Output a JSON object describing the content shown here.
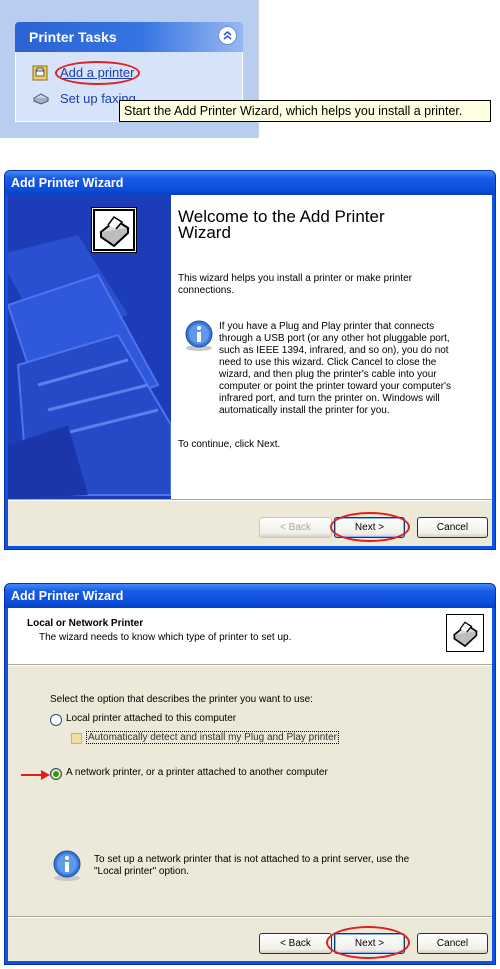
{
  "printer_tasks": {
    "title": "Printer Tasks",
    "items": [
      {
        "label": "Add a printer",
        "icon": "add-printer-icon"
      },
      {
        "label": "Set up faxing",
        "icon": "fax-icon"
      }
    ],
    "tooltip": "Start the Add Printer Wizard, which helps you install a printer."
  },
  "wizard1": {
    "window_title": "Add Printer Wizard",
    "heading": "Welcome to the Add Printer Wizard",
    "intro": "This wizard helps you install a printer or make printer connections.",
    "info": "If you have a Plug and Play printer that connects through a USB port (or any other hot pluggable port, such as IEEE 1394, infrared, and so on), you do not need to use this wizard. Click Cancel to close the wizard, and then plug the printer's cable into your computer or point the printer toward your computer's infrared port, and turn the printer on. Windows will automatically install the printer for you.",
    "continue_text": "To continue, click Next.",
    "buttons": {
      "back": "< Back",
      "next": "Next >",
      "cancel": "Cancel"
    }
  },
  "wizard2": {
    "window_title": "Add Printer Wizard",
    "header_title": "Local or Network Printer",
    "header_subtitle": "The wizard needs to know which type of printer to set up.",
    "prompt": "Select the option that describes the printer you want to use:",
    "options": {
      "local": "Local printer attached to this computer",
      "auto_detect": "Automatically detect and install my Plug and Play printer",
      "network": "A network printer, or a printer attached to another computer"
    },
    "selected_option": "network",
    "info": "To set up a network printer that is not attached to a print server, use the \"Local printer\" option.",
    "buttons": {
      "back": "< Back",
      "next": "Next >",
      "cancel": "Cancel"
    }
  },
  "colors": {
    "annotation_red": "#e0201e",
    "xp_blue": "#0a54e4",
    "panel_blue": "#b9cdf1"
  }
}
